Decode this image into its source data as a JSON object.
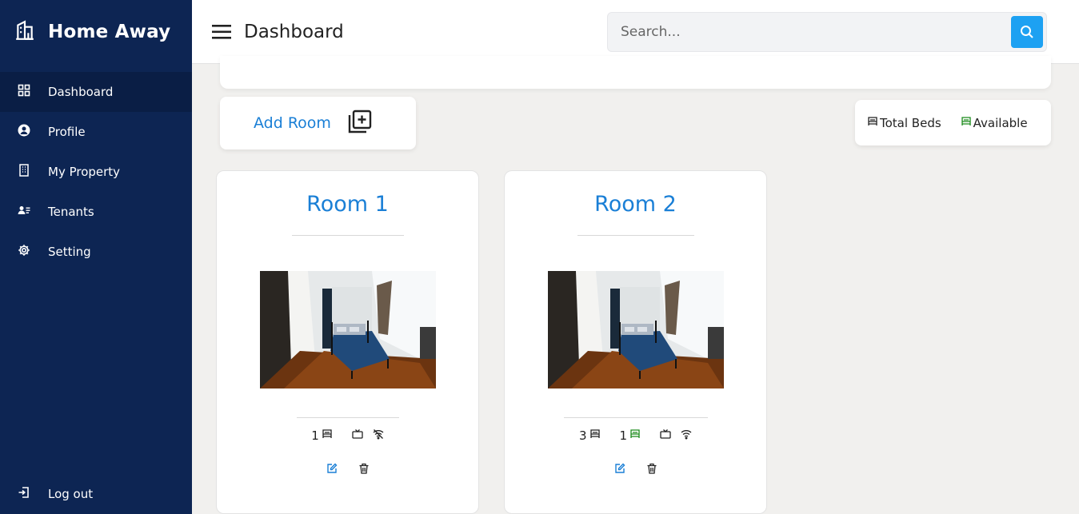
{
  "app": {
    "brand": "Home Away"
  },
  "header": {
    "title": "Dashboard",
    "search_placeholder": "Search..."
  },
  "sidebar": {
    "items": [
      {
        "label": "Dashboard",
        "icon": "grid-icon",
        "active": true
      },
      {
        "label": "Profile",
        "icon": "user-circle-icon"
      },
      {
        "label": "My Property",
        "icon": "building-icon"
      },
      {
        "label": "Tenants",
        "icon": "tenants-icon"
      },
      {
        "label": "Setting",
        "icon": "gear-icon"
      }
    ],
    "logout": "Log out"
  },
  "add_room": {
    "label": "Add Room",
    "icon": "plus-square-icon"
  },
  "legend": {
    "total_beds": "Total Beds",
    "available": "Available",
    "total_color": "#222222",
    "available_color": "#1a8a1a"
  },
  "rooms": [
    {
      "title": "Room 1",
      "total_beds": "1",
      "available_beds": "",
      "tv_icon": "tv-icon",
      "wifi_icon": "wifi-off-icon"
    },
    {
      "title": "Room 2",
      "total_beds": "3",
      "available_beds": "1",
      "tv_icon": "tv-icon",
      "wifi_icon": "wifi-icon"
    }
  ],
  "colors": {
    "sidebar": "#0d2553",
    "accent": "#1a7fd6",
    "search_button": "#1da1f2"
  }
}
